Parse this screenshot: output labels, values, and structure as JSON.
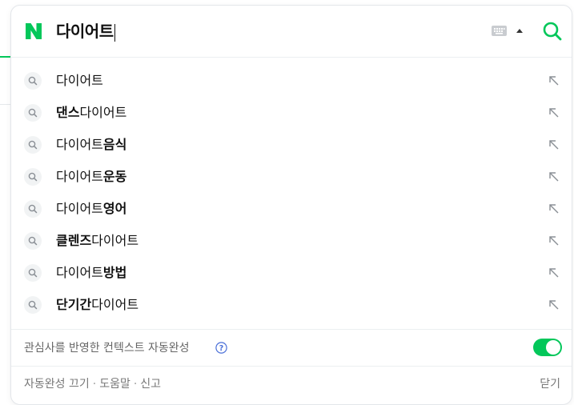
{
  "search": {
    "query": "다이어트",
    "brand_color": "#03c75a",
    "logo_letter": "N",
    "icons": {
      "logo": "naver-n-icon",
      "keyboard": "keyboard-icon",
      "toggle_arrow": "chevron-up-icon",
      "search": "search-icon"
    }
  },
  "suggestions": [
    {
      "normal_prefix": "",
      "bold": "",
      "normal": "다이어트"
    },
    {
      "normal_prefix": "",
      "bold": "댄스",
      "normal": "다이어트"
    },
    {
      "normal_prefix": "다이어트",
      "bold": "음식",
      "normal": ""
    },
    {
      "normal_prefix": "다이어트",
      "bold": "운동",
      "normal": ""
    },
    {
      "normal_prefix": "다이어트",
      "bold": "영어",
      "normal": ""
    },
    {
      "normal_prefix": "",
      "bold": "클렌즈",
      "normal": "다이어트"
    },
    {
      "normal_prefix": "다이어트",
      "bold": "방법",
      "normal": ""
    },
    {
      "normal_prefix": "",
      "bold": "단기간",
      "normal": "다이어트"
    }
  ],
  "context": {
    "label": "관심사를 반영한 컨텍스트 자동완성",
    "enabled": true
  },
  "footer": {
    "autocomplete_off": "자동완성 끄기",
    "help": "도움말",
    "report": "신고",
    "separator": "·",
    "close": "닫기"
  }
}
